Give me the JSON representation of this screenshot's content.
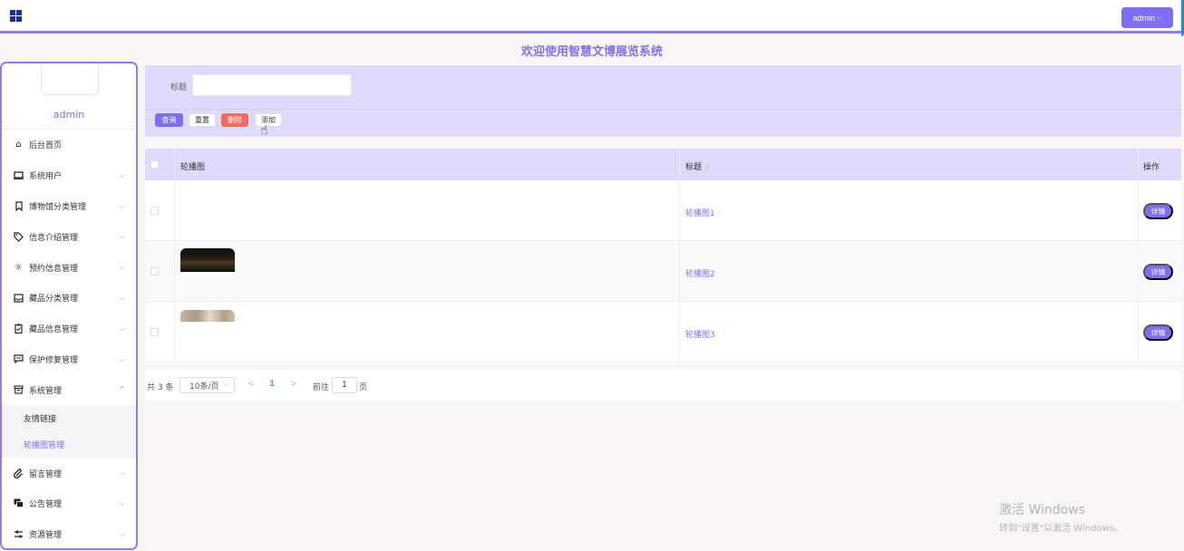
{
  "header": {
    "user_menu_label": "admin",
    "title": "欢迎使用智慧文博展览系统"
  },
  "sidebar": {
    "username": "admin",
    "items": [
      {
        "label": "后台首页",
        "icon": "home-icon",
        "chevron": false
      },
      {
        "label": "系统用户",
        "icon": "monitor-icon",
        "chevron": true
      },
      {
        "label": "博物馆分类管理",
        "icon": "bookmark-icon",
        "chevron": true
      },
      {
        "label": "信息介绍管理",
        "icon": "tag-icon",
        "chevron": true
      },
      {
        "label": "预约信息管理",
        "icon": "sun-icon",
        "chevron": true
      },
      {
        "label": "藏品分类管理",
        "icon": "inbox-icon",
        "chevron": true
      },
      {
        "label": "藏品信息管理",
        "icon": "clipboard-icon",
        "chevron": true
      },
      {
        "label": "保护修复管理",
        "icon": "message-icon",
        "chevron": true
      },
      {
        "label": "系统管理",
        "icon": "box-icon",
        "chevron": true,
        "expanded": true
      }
    ],
    "sub_items": [
      {
        "label": "友情链接",
        "active": false
      },
      {
        "label": "轮播图管理",
        "active": true
      }
    ],
    "items_after": [
      {
        "label": "留言管理",
        "icon": "paperclip-icon"
      },
      {
        "label": "公告管理",
        "icon": "chat-icon"
      },
      {
        "label": "资源管理",
        "icon": "sliders-icon"
      }
    ]
  },
  "search": {
    "title_label": "标题",
    "title_value": "",
    "buttons": {
      "query": "查询",
      "reset": "重置",
      "delete": "删除",
      "add": "添加"
    }
  },
  "table": {
    "columns": {
      "image": "轮播图",
      "title": "标题",
      "action": "操作"
    },
    "rows": [
      {
        "title": "轮播图1",
        "action": "详情"
      },
      {
        "title": "轮播图2",
        "action": "详情"
      },
      {
        "title": "轮播图3",
        "action": "详情"
      }
    ]
  },
  "pagination": {
    "total": "共 3 条",
    "page_size": "10条/页",
    "prev": "<",
    "current": "1",
    "next": ">",
    "goto_label": "前往",
    "goto_value": "1",
    "page_suffix": "页"
  },
  "watermark": {
    "line1": "激活 Windows",
    "line2": "转到\"设置\"以激活 Windows。"
  },
  "colors": {
    "accent": "#7f6ff0",
    "danger": "#ef6b5d",
    "panel": "#dddafb",
    "title": "#8370ea"
  }
}
